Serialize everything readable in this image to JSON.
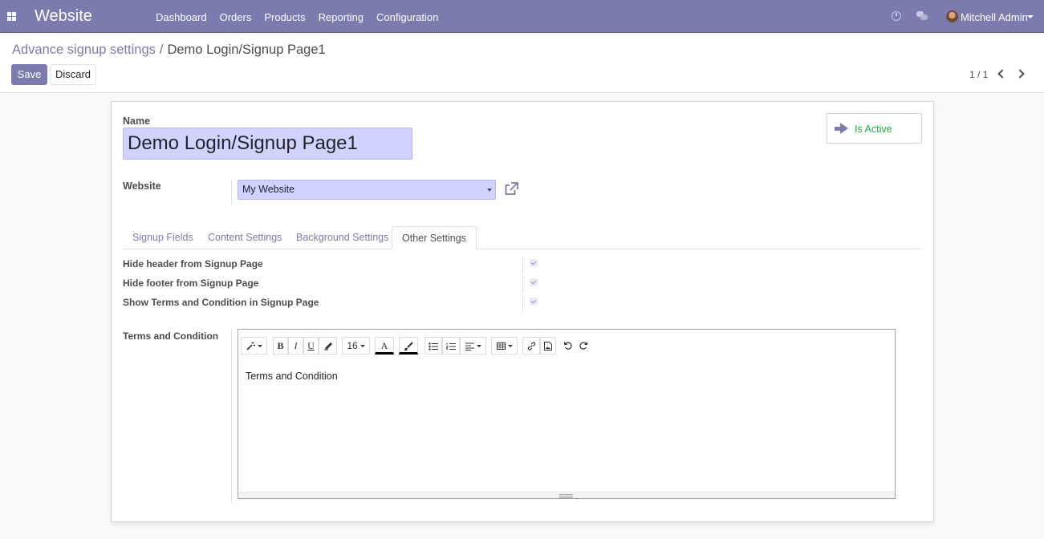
{
  "navbar": {
    "app_title": "Website",
    "menu": [
      "Dashboard",
      "Orders",
      "Products",
      "Reporting",
      "Configuration"
    ],
    "user_name": "Mitchell Admin",
    "icons": [
      "apps-icon",
      "clock-icon",
      "chat-icon",
      "avatar",
      "caret-down-icon"
    ]
  },
  "breadcrumb": {
    "parent": "Advance signup settings",
    "separator": "/",
    "current": "Demo Login/Signup Page1"
  },
  "buttons": {
    "save": "Save",
    "discard": "Discard"
  },
  "pager": {
    "value": "1 / 1"
  },
  "form": {
    "name_label": "Name",
    "name_value": "Demo Login/Signup Page1",
    "is_active_label": "Is Active",
    "website_label": "Website",
    "website_value": "My Website",
    "tabs": [
      "Signup Fields",
      "Content Settings",
      "Background Settings",
      "Other Settings"
    ],
    "active_tab": "Other Settings",
    "booleans": [
      {
        "label": "Hide header from Signup Page",
        "checked": true
      },
      {
        "label": "Hide footer from Signup Page",
        "checked": true
      },
      {
        "label": "Show Terms and Condition in Signup Page",
        "checked": true
      }
    ],
    "terms_label": "Terms and Condition",
    "editor": {
      "font_size": "16",
      "content": "Terms and Condition"
    }
  },
  "colors": {
    "brand": "#7c7bad",
    "field_bg": "#d2d2ff",
    "active_green": "#28a745"
  }
}
